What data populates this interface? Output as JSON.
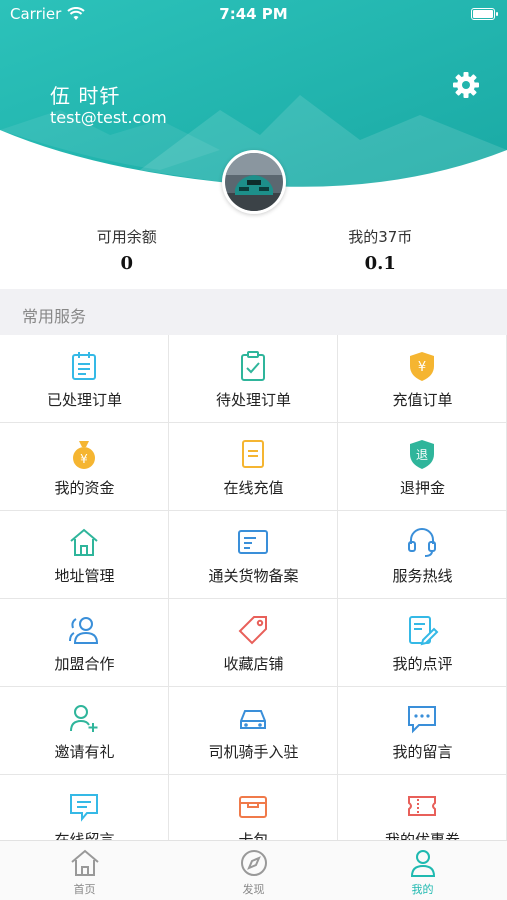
{
  "status_bar": {
    "carrier": "Carrier",
    "time": "7:44 PM"
  },
  "profile": {
    "name": "伍 时钎",
    "email": "test@test.com"
  },
  "balances": [
    {
      "label": "可用余额",
      "value": "0"
    },
    {
      "label": "我的37币",
      "value": "0.1"
    }
  ],
  "services": {
    "title": "常用服务",
    "items": [
      {
        "label": "已处理订单",
        "icon": "calendar-list-icon"
      },
      {
        "label": "待处理订单",
        "icon": "clipboard-check-icon"
      },
      {
        "label": "充值订单",
        "icon": "yen-shield-icon"
      },
      {
        "label": "我的资金",
        "icon": "money-bag-icon"
      },
      {
        "label": "在线充值",
        "icon": "document-icon"
      },
      {
        "label": "退押金",
        "icon": "refund-shield-icon"
      },
      {
        "label": "地址管理",
        "icon": "home-icon"
      },
      {
        "label": "通关货物备案",
        "icon": "id-card-icon"
      },
      {
        "label": "服务热线",
        "icon": "headset-icon"
      },
      {
        "label": "加盟合作",
        "icon": "users-icon"
      },
      {
        "label": "收藏店铺",
        "icon": "tag-icon"
      },
      {
        "label": "我的点评",
        "icon": "edit-note-icon"
      },
      {
        "label": "邀请有礼",
        "icon": "user-add-icon"
      },
      {
        "label": "司机骑手入驻",
        "icon": "car-icon"
      },
      {
        "label": "我的留言",
        "icon": "chat-bubble-icon"
      },
      {
        "label": "在线留言",
        "icon": "message-icon"
      },
      {
        "label": "卡包",
        "icon": "wallet-icon"
      },
      {
        "label": "我的优惠券",
        "icon": "coupon-icon"
      }
    ]
  },
  "tabbar": {
    "items": [
      {
        "label": "首页",
        "icon": "home-tab-icon"
      },
      {
        "label": "发现",
        "icon": "compass-icon"
      },
      {
        "label": "我的",
        "icon": "person-icon"
      }
    ],
    "active": "我的"
  },
  "colors": {
    "accent": "#1fb9b0",
    "header_top": "#2cbcb4",
    "section_bg": "#f1f1f4"
  }
}
